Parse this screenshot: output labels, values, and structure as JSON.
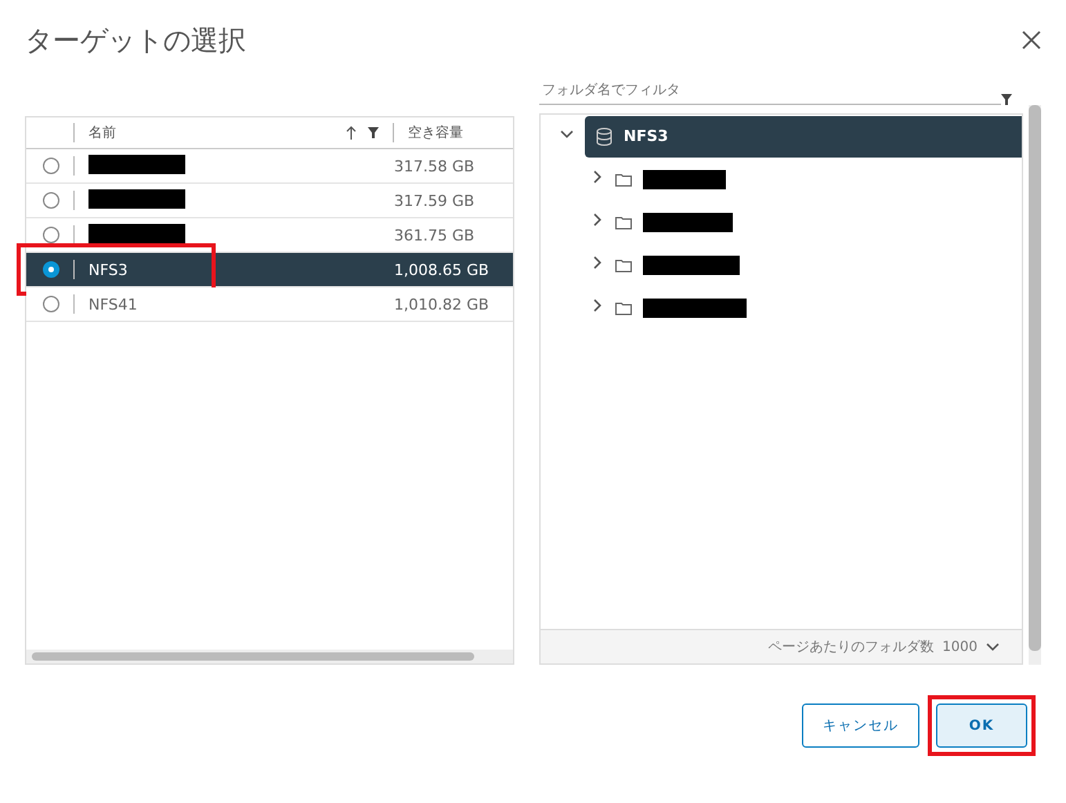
{
  "dialog": {
    "title": "ターゲットの選択"
  },
  "table": {
    "columns": [
      {
        "label": "名前"
      },
      {
        "label": "空き容量"
      }
    ],
    "rows": [
      {
        "redacted": true,
        "free": "317.58 GB",
        "selected": false,
        "annotated": false
      },
      {
        "redacted": true,
        "free": "317.59 GB",
        "selected": false,
        "annotated": false
      },
      {
        "redacted": true,
        "free": "361.75 GB",
        "selected": false,
        "annotated": false
      },
      {
        "redacted": false,
        "name": "NFS3",
        "free": "1,008.65 GB",
        "selected": true,
        "annotated": true
      },
      {
        "redacted": false,
        "name": "NFS41",
        "free": "1,010.82 GB",
        "selected": false,
        "annotated": false
      }
    ]
  },
  "folder_panel": {
    "filter": {
      "placeholder": "フォルダ名でフィルタ"
    },
    "tree": [
      {
        "name": "NFS3",
        "expanded": true,
        "selected": true,
        "children": [
          {
            "redacted": true,
            "expanded": false,
            "selected": false
          },
          {
            "redacted": true,
            "expanded": false,
            "selected": false
          },
          {
            "redacted": true,
            "expanded": false,
            "selected": false
          },
          {
            "redacted": true,
            "expanded": false,
            "selected": false
          }
        ]
      }
    ],
    "page_size_label": "ページあたりのフォルダ数",
    "page_size": "1000"
  },
  "buttons": [
    {
      "label": "キャンセル",
      "kind": "secondary",
      "annotated": false
    },
    {
      "label": "OK",
      "kind": "primary",
      "annotated": true
    }
  ]
}
